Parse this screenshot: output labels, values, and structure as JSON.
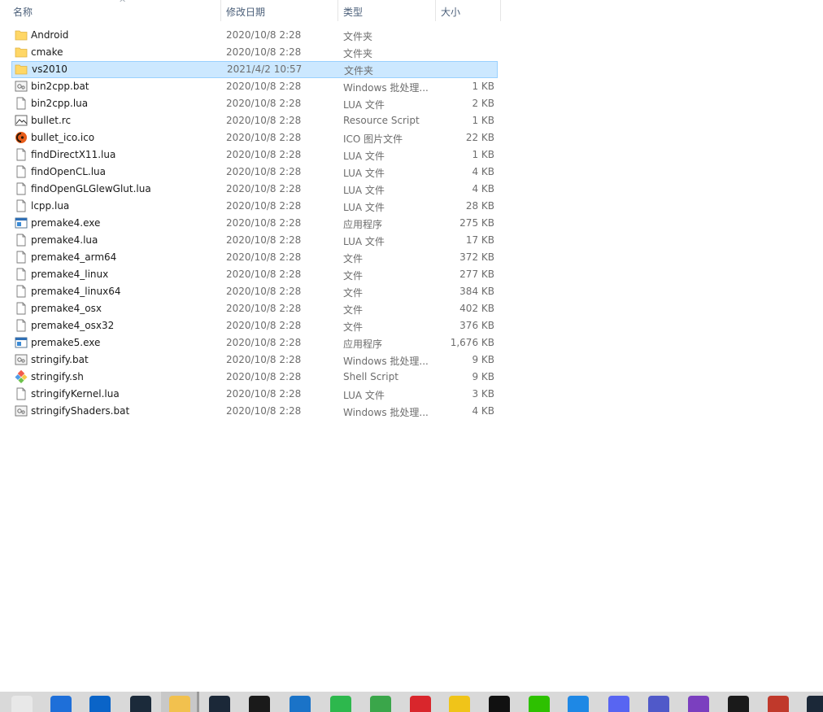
{
  "columns": {
    "name": "名称",
    "date": "修改日期",
    "type": "类型",
    "size": "大小"
  },
  "sort_indicator": "^",
  "files": [
    {
      "name": "Android",
      "date": "2020/10/8 2:28",
      "type": "文件夹",
      "size": "",
      "icon": "folder-icon"
    },
    {
      "name": "cmake",
      "date": "2020/10/8 2:28",
      "type": "文件夹",
      "size": "",
      "icon": "folder-icon"
    },
    {
      "name": "vs2010",
      "date": "2021/4/2 10:57",
      "type": "文件夹",
      "size": "",
      "icon": "folder-icon",
      "selected": true
    },
    {
      "name": "bin2cpp.bat",
      "date": "2020/10/8 2:28",
      "type": "Windows 批处理...",
      "size": "1 KB",
      "icon": "batch-file-icon"
    },
    {
      "name": "bin2cpp.lua",
      "date": "2020/10/8 2:28",
      "type": "LUA 文件",
      "size": "2 KB",
      "icon": "blank-file-icon"
    },
    {
      "name": "bullet.rc",
      "date": "2020/10/8 2:28",
      "type": "Resource Script",
      "size": "1 KB",
      "icon": "resource-file-icon"
    },
    {
      "name": "bullet_ico.ico",
      "date": "2020/10/8 2:28",
      "type": "ICO 图片文件",
      "size": "22 KB",
      "icon": "bullet-logo-icon"
    },
    {
      "name": "findDirectX11.lua",
      "date": "2020/10/8 2:28",
      "type": "LUA 文件",
      "size": "1 KB",
      "icon": "blank-file-icon"
    },
    {
      "name": "findOpenCL.lua",
      "date": "2020/10/8 2:28",
      "type": "LUA 文件",
      "size": "4 KB",
      "icon": "blank-file-icon"
    },
    {
      "name": "findOpenGLGlewGlut.lua",
      "date": "2020/10/8 2:28",
      "type": "LUA 文件",
      "size": "4 KB",
      "icon": "blank-file-icon"
    },
    {
      "name": "lcpp.lua",
      "date": "2020/10/8 2:28",
      "type": "LUA 文件",
      "size": "28 KB",
      "icon": "blank-file-icon"
    },
    {
      "name": "premake4.exe",
      "date": "2020/10/8 2:28",
      "type": "应用程序",
      "size": "275 KB",
      "icon": "exe-file-icon"
    },
    {
      "name": "premake4.lua",
      "date": "2020/10/8 2:28",
      "type": "LUA 文件",
      "size": "17 KB",
      "icon": "blank-file-icon"
    },
    {
      "name": "premake4_arm64",
      "date": "2020/10/8 2:28",
      "type": "文件",
      "size": "372 KB",
      "icon": "blank-file-icon"
    },
    {
      "name": "premake4_linux",
      "date": "2020/10/8 2:28",
      "type": "文件",
      "size": "277 KB",
      "icon": "blank-file-icon"
    },
    {
      "name": "premake4_linux64",
      "date": "2020/10/8 2:28",
      "type": "文件",
      "size": "384 KB",
      "icon": "blank-file-icon"
    },
    {
      "name": "premake4_osx",
      "date": "2020/10/8 2:28",
      "type": "文件",
      "size": "402 KB",
      "icon": "blank-file-icon"
    },
    {
      "name": "premake4_osx32",
      "date": "2020/10/8 2:28",
      "type": "文件",
      "size": "376 KB",
      "icon": "blank-file-icon"
    },
    {
      "name": "premake5.exe",
      "date": "2020/10/8 2:28",
      "type": "应用程序",
      "size": "1,676 KB",
      "icon": "exe-file-icon"
    },
    {
      "name": "stringify.bat",
      "date": "2020/10/8 2:28",
      "type": "Windows 批处理...",
      "size": "9 KB",
      "icon": "batch-file-icon"
    },
    {
      "name": "stringify.sh",
      "date": "2020/10/8 2:28",
      "type": "Shell Script",
      "size": "9 KB",
      "icon": "shell-script-icon"
    },
    {
      "name": "stringifyKernel.lua",
      "date": "2020/10/8 2:28",
      "type": "LUA 文件",
      "size": "3 KB",
      "icon": "blank-file-icon"
    },
    {
      "name": "stringifyShaders.bat",
      "date": "2020/10/8 2:28",
      "type": "Windows 批处理...",
      "size": "4 KB",
      "icon": "batch-file-icon"
    }
  ],
  "taskbar": [
    {
      "name": "store-icon",
      "color": "#e8e8e8"
    },
    {
      "name": "clock-icon",
      "color": "#1e6fd9"
    },
    {
      "name": "mail-icon",
      "color": "#0a64c8"
    },
    {
      "name": "dev-tool-icon",
      "color": "#1b2a3a"
    },
    {
      "name": "file-explorer-icon",
      "color": "#f2c14e"
    },
    {
      "name": "steam-icon",
      "color": "#1b2838"
    },
    {
      "name": "g-app-icon",
      "color": "#1a1a1a"
    },
    {
      "name": "uplay-icon",
      "color": "#1a73c8"
    },
    {
      "name": "green-plus-icon",
      "color": "#2db84d"
    },
    {
      "name": "shield-icon",
      "color": "#3aa64a"
    },
    {
      "name": "netease-music-icon",
      "color": "#d9262c"
    },
    {
      "name": "yellow-app-icon",
      "color": "#f0c419"
    },
    {
      "name": "qq-icon",
      "color": "#111111"
    },
    {
      "name": "wechat-icon",
      "color": "#2dc100"
    },
    {
      "name": "star-app-icon",
      "color": "#1e88e5"
    },
    {
      "name": "discord-icon",
      "color": "#5865f2"
    },
    {
      "name": "teams-icon",
      "color": "#5059c9"
    },
    {
      "name": "visual-studio-icon",
      "color": "#7b3fbf"
    },
    {
      "name": "oculus-icon",
      "color": "#1a1a1a"
    },
    {
      "name": "spider-app-icon",
      "color": "#c0392b"
    },
    {
      "name": "steam-icon-2",
      "color": "#1b2838"
    }
  ]
}
